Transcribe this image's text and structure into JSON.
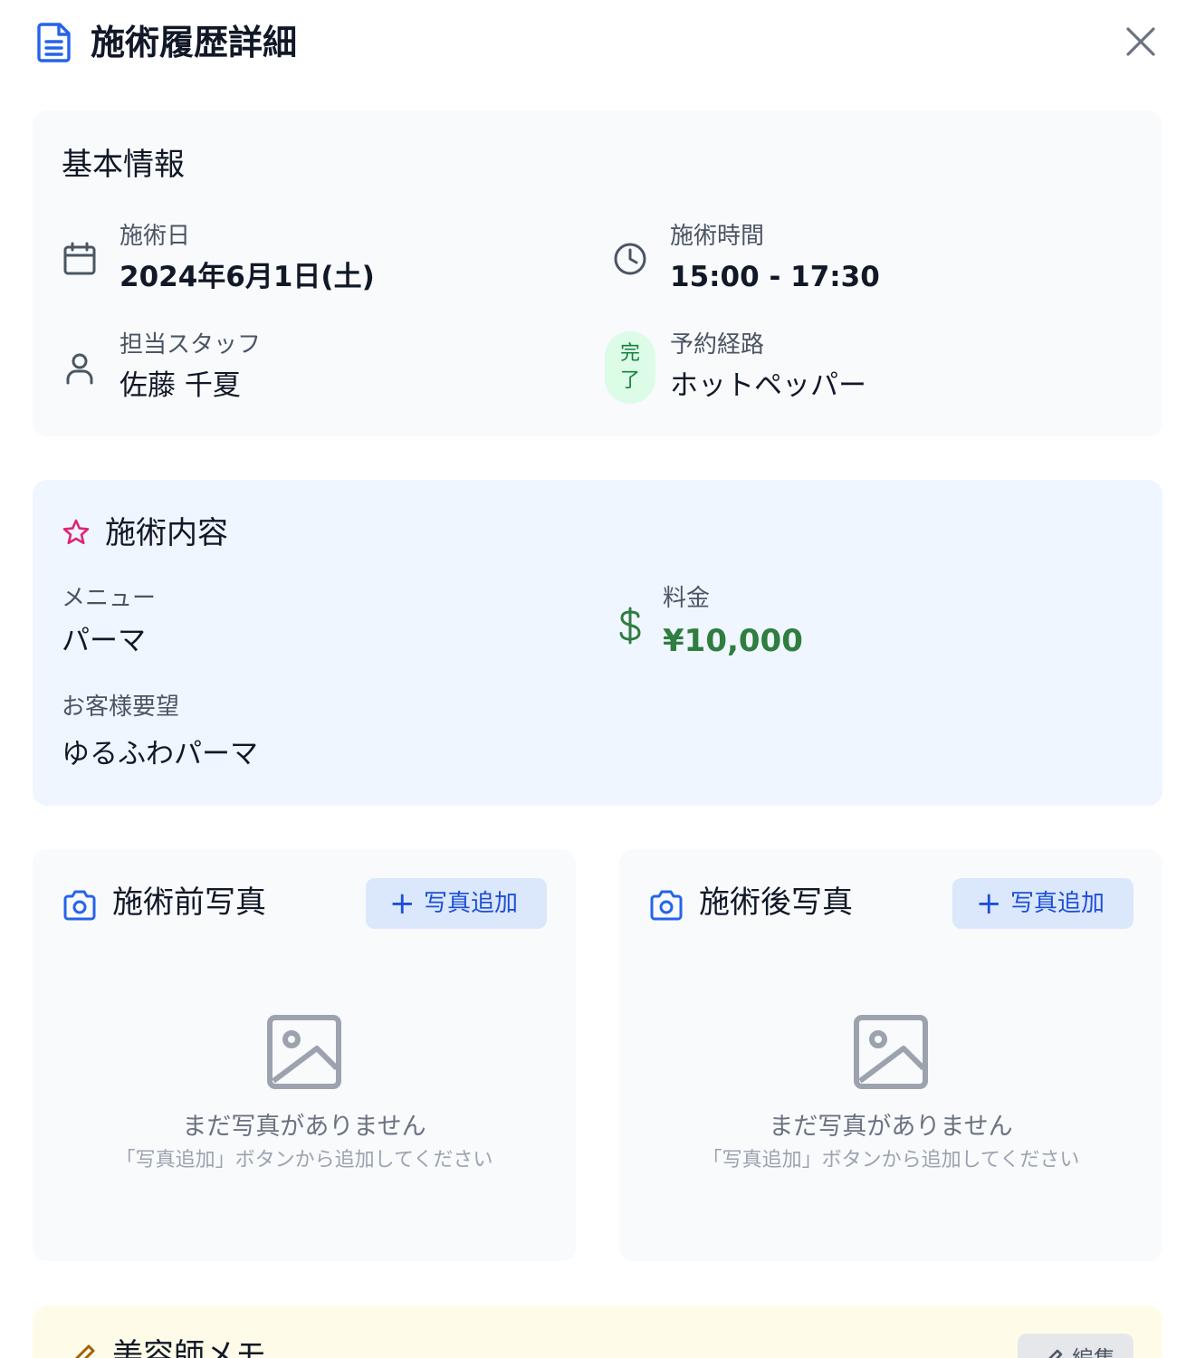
{
  "header": {
    "title": "施術履歴詳細"
  },
  "basic": {
    "title": "基本情報",
    "date": {
      "label": "施術日",
      "value": "2024年6月1日(土)"
    },
    "time": {
      "label": "施術時間",
      "value": "15:00 - 17:30"
    },
    "staff": {
      "label": "担当スタッフ",
      "value": "佐藤 千夏"
    },
    "route": {
      "label": "予約経路",
      "value": "ホットペッパー",
      "status_top": "完",
      "status_bottom": "了"
    }
  },
  "service": {
    "title": "施術内容",
    "menu": {
      "label": "メニュー",
      "value": "パーマ"
    },
    "price": {
      "label": "料金",
      "value": "¥10,000"
    },
    "request": {
      "label": "お客様要望",
      "value": "ゆるふわパーマ"
    }
  },
  "photos": {
    "before": {
      "title": "施術前写真",
      "add_label": "写真追加",
      "empty_title": "まだ写真がありません",
      "empty_sub": "「写真追加」ボタンから追加してください"
    },
    "after": {
      "title": "施術後写真",
      "add_label": "写真追加",
      "empty_title": "まだ写真がありません",
      "empty_sub": "「写真追加」ボタンから追加してください"
    }
  },
  "memo": {
    "title": "美容師メモ",
    "edit_label": "編集"
  },
  "colors": {
    "accent_blue": "#2563eb",
    "price_green": "#2f7d3f",
    "star_pink": "#db2777",
    "status_bg": "#dcfce7"
  }
}
